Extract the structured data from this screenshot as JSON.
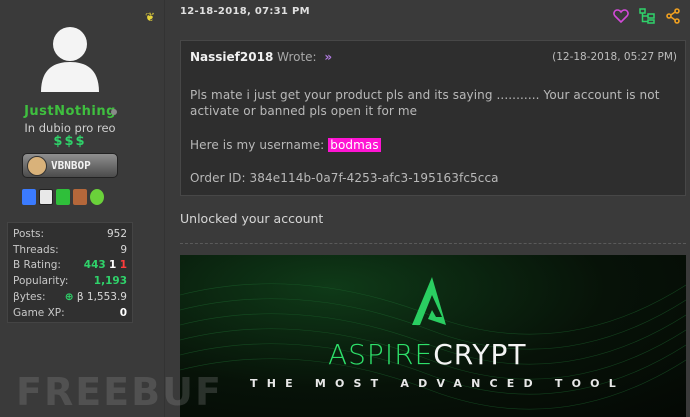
{
  "user": {
    "name": "JustNothing",
    "title": "In dubio pro reo",
    "money": "$$$",
    "rank_badge": "VBNBOP",
    "stats": [
      {
        "label": "Posts:",
        "value": "952"
      },
      {
        "label": "Threads:",
        "value": "9"
      },
      {
        "label": "B Rating:",
        "parts": [
          "443",
          "1",
          "1"
        ]
      },
      {
        "label": "Popularity:",
        "value": "1,193"
      },
      {
        "label": "βytes:",
        "value": "β 1,553.9"
      },
      {
        "label": "Game XP:",
        "value": "0"
      }
    ]
  },
  "post": {
    "date": "12-18-2018, 07:31 PM",
    "quote": {
      "user": "Nassief2018",
      "wrote": "Wrote:",
      "arrow": "»",
      "date": "(12-18-2018, 05:27 PM)",
      "line1": "Pls mate i just get your product  pls and its saying ........... Your account is not",
      "line2": "activate or banned pls open it for me",
      "line3_prefix": "Here is my username: ",
      "username_highlight": "bodmas",
      "line4": "Order ID: 384e114b-0a7f-4253-afc3-195163fc5cca"
    },
    "reply": "Unlocked your account"
  },
  "banner": {
    "brand_left": "ASPIRE",
    "brand_right": "CRYPT",
    "tagline": "THE MOST ADVANCED TOOL"
  },
  "watermark": "FREEBUF",
  "colors": {
    "username": "#3fbf3f",
    "money": "#2fd26a",
    "highlight": "#ff14d3",
    "heart": "#d24ad8",
    "tree": "#2fd26a",
    "share": "#f0a020"
  }
}
